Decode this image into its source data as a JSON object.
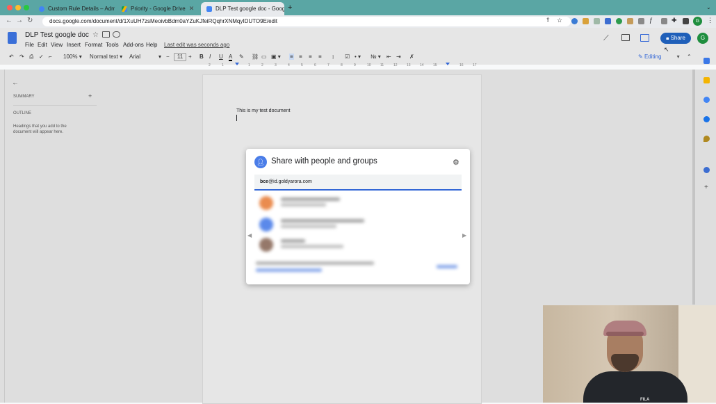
{
  "browser": {
    "tabs": [
      {
        "title": "Custom Rule Details – Admin C",
        "active": false
      },
      {
        "title": "Priority - Google Drive",
        "active": false
      },
      {
        "title": "DLP Test google doc - Google",
        "active": true
      }
    ],
    "new_tab": "+",
    "url": "docs.google.com/document/d/1XuUH7zsMeoivbBdm0aYZuKJfeiRQqhrXNMqyIDUTO9E/edit",
    "profile_initial": "G"
  },
  "doc": {
    "title": "DLP Test google doc",
    "menu": [
      "File",
      "Edit",
      "View",
      "Insert",
      "Format",
      "Tools",
      "Add-ons",
      "Help"
    ],
    "last_edit": "Last edit was seconds ago",
    "share_label": "Share",
    "avatar_initial": "G",
    "toolbar": {
      "zoom": "100%",
      "style": "Normal text",
      "font": "Arial",
      "font_size": "11",
      "bold": "B",
      "italic": "I",
      "underline": "U",
      "text_color": "A",
      "editing": "Editing"
    },
    "ruler_ticks": [
      "2",
      "1",
      "1",
      "2",
      "3",
      "4",
      "5",
      "6",
      "7",
      "8",
      "9",
      "10",
      "11",
      "12",
      "13",
      "14",
      "15",
      "16",
      "17",
      "18"
    ],
    "outline": {
      "summary": "SUMMARY",
      "summary_add": "+",
      "outline": "OUTLINE",
      "hint": "Headings that you add to the document will appear here."
    },
    "body_text": "This is my test document"
  },
  "share_dialog": {
    "title": "Share with people and groups",
    "input_bold": "bce",
    "input_rest": "@id.goldyarora.com"
  },
  "colors": {
    "accent": "#1a73e8",
    "tabstrip": "#5aa6a4",
    "share_button": "#1f5fb9"
  }
}
